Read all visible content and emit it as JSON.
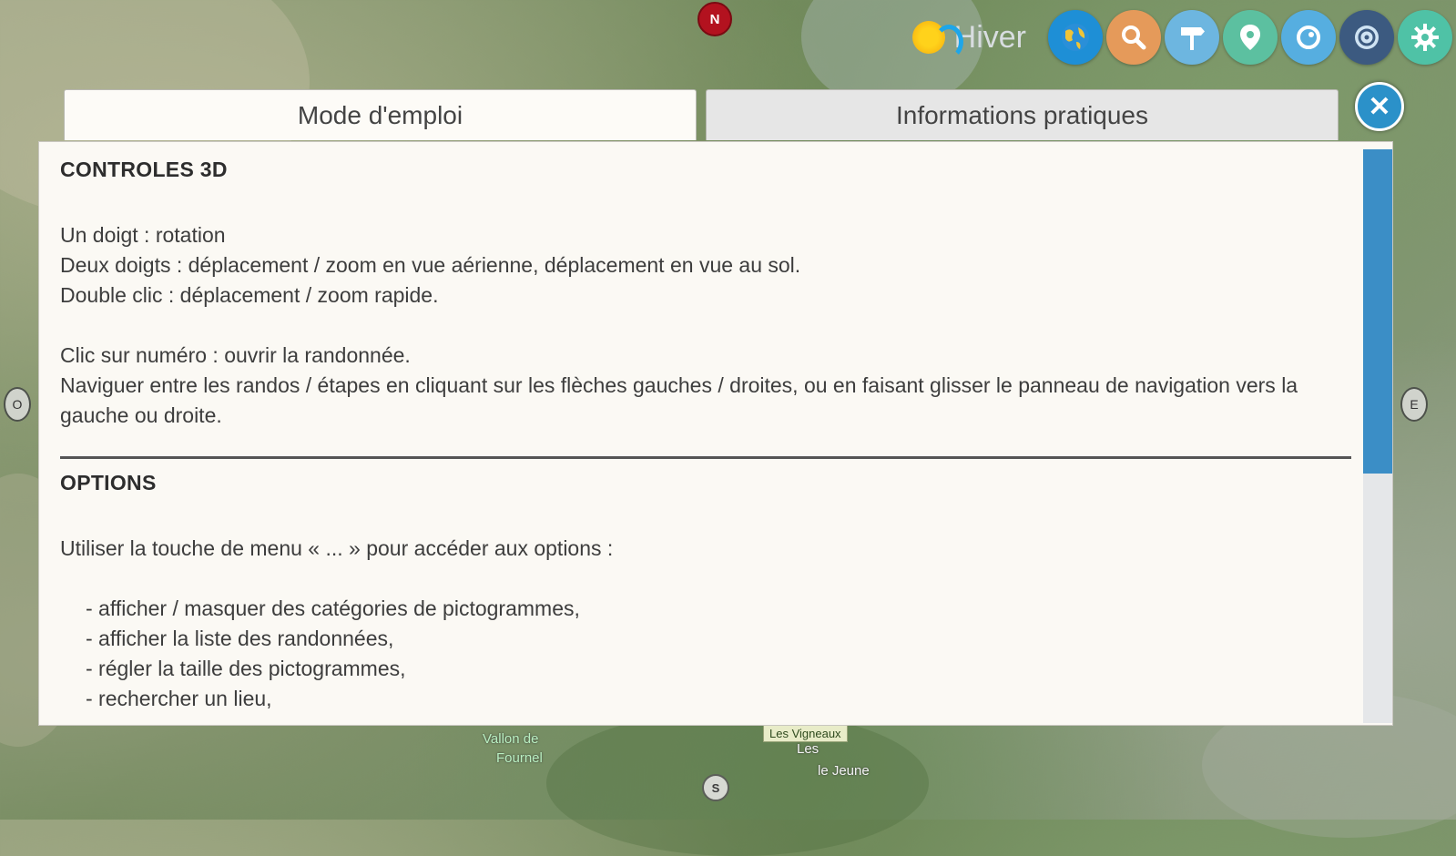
{
  "toolbar": {
    "season_label": "Hiver",
    "buttons": [
      {
        "name": "globe-button",
        "icon": "globe-icon",
        "color": "#1e8fd6"
      },
      {
        "name": "search-button",
        "icon": "search-icon",
        "color": "#e59a5a"
      },
      {
        "name": "signpost-button",
        "icon": "signpost-icon",
        "color": "#6db6e0"
      },
      {
        "name": "location-button",
        "icon": "location-pin-icon",
        "color": "#5cc0a0"
      },
      {
        "name": "compass-button",
        "icon": "compass-icon",
        "color": "#56aee0"
      },
      {
        "name": "target-button",
        "icon": "target-icon",
        "color": "#3c5a80"
      },
      {
        "name": "settings-button",
        "icon": "gear-icon",
        "color": "#4fc2a6"
      }
    ]
  },
  "map": {
    "north_marker": "N",
    "south_marker": "S",
    "side_markers": [
      "O",
      "E"
    ],
    "labels": [
      "Vallon de",
      "Fournel",
      "Les",
      "Vigneaux",
      "Les Vigneaux",
      "le Jeune"
    ]
  },
  "dialog": {
    "tabs": [
      {
        "label": "Mode d'emploi",
        "active": true
      },
      {
        "label": "Informations pratiques",
        "active": false
      }
    ],
    "close_symbol": "✕",
    "scroll_position": 0.0
  },
  "content": {
    "section1": {
      "heading": "CONTROLES 3D",
      "lines": [
        "Un doigt : rotation",
        "Deux doigts : déplacement / zoom en vue aérienne, déplacement en vue au sol.",
        "Double clic : déplacement / zoom rapide."
      ],
      "lines2": [
        "Clic sur numéro : ouvrir la randonnée.",
        "Naviguer entre les randos / étapes en cliquant sur les flèches gauches / droites, ou en faisant glisser le panneau de navigation vers la gauche ou droite."
      ]
    },
    "section2": {
      "heading": "OPTIONS",
      "intro": "Utiliser la touche de menu « ... » pour accéder aux options :",
      "bullets": [
        "- afficher / masquer des catégories de pictogrammes,",
        "- afficher la liste des randonnées,",
        "- régler la taille des pictogrammes,",
        "- rechercher un lieu,"
      ]
    }
  }
}
